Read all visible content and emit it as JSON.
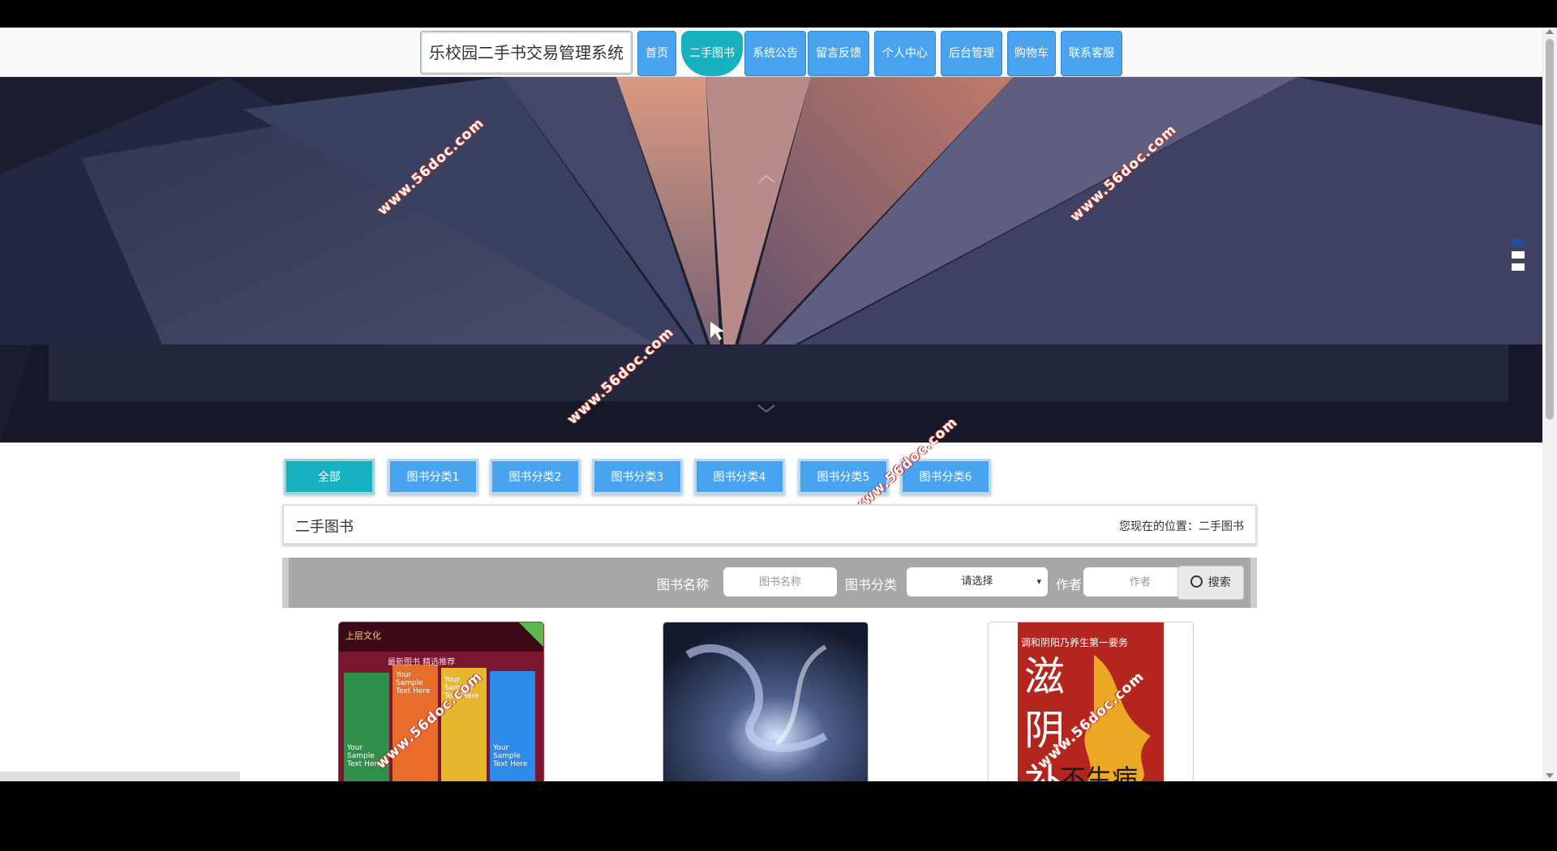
{
  "header": {
    "site_title": "乐校园二手书交易管理系统",
    "nav": [
      "首页",
      "二手图书",
      "系统公告",
      "留言反馈",
      "个人中心",
      "后台管理",
      "购物车",
      "联系客服"
    ],
    "active_nav_index": 1
  },
  "banner": {
    "slide_count": 3,
    "active_slide": 0
  },
  "watermark": "www.56doc.com",
  "categories": {
    "items": [
      "全部",
      "图书分类1",
      "图书分类2",
      "图书分类3",
      "图书分类4",
      "图书分类5",
      "图书分类6"
    ],
    "active_index": 0
  },
  "section": {
    "title": "二手图书",
    "breadcrumb": "您现在的位置：二手图书"
  },
  "search": {
    "name_label": "图书名称",
    "name_placeholder": "图书名称",
    "category_label": "图书分类",
    "category_selected": "请选择",
    "author_label": "作者",
    "author_placeholder": "作者",
    "button_label": "搜索"
  },
  "books": [
    {
      "cover_text_top": "上层文化",
      "cover_text_mid": "最新图书  精选推荐",
      "cover_samples": [
        "Your Sample Text Here",
        "Your Sample Text Here",
        "Your Sample Text Here",
        "Your Sample Text Here"
      ]
    },
    {
      "cover_text_top": ""
    },
    {
      "cover_text_top": "调和阴阳乃养生第一要务",
      "cover_title": "滋阴补阳",
      "cover_subtitle": "不生病"
    }
  ],
  "colors": {
    "nav_blue": "#4aa3ef",
    "active_teal": "#17b1c0",
    "search_gray": "#a7a7a7"
  }
}
